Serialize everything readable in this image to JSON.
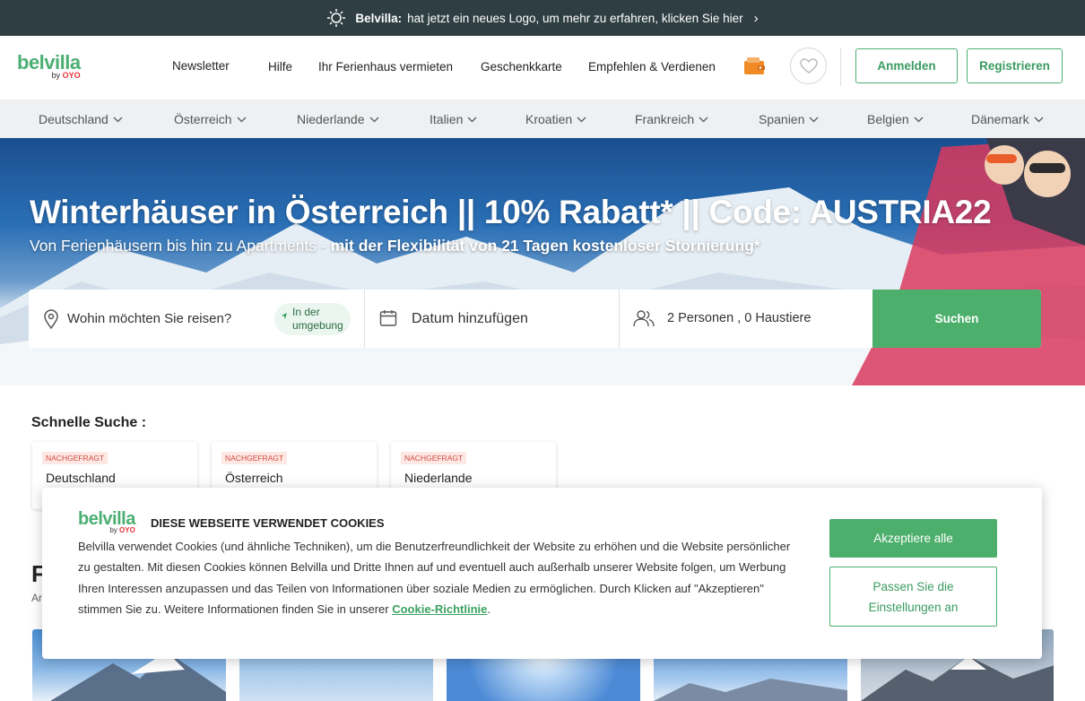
{
  "announcement": {
    "brand": "Belvilla:",
    "text": "hat jetzt ein neues Logo, um mehr zu erfahren, klicken Sie hier"
  },
  "header": {
    "logo": {
      "word": "belvilla",
      "by": "by",
      "oyo": "OYO"
    },
    "nav": [
      "Newsletter",
      "Hilfe",
      "Ihr Ferienhaus vermieten",
      "Geschenkkarte",
      "Empfehlen & Verdienen"
    ],
    "login_label": "Anmelden",
    "register_label": "Registrieren"
  },
  "countries": [
    "Deutschland",
    "Österreich",
    "Niederlande",
    "Italien",
    "Kroatien",
    "Frankreich",
    "Spanien",
    "Belgien",
    "Dänemark"
  ],
  "hero": {
    "title": "Winterhäuser in Österreich || 10% Rabatt* || Code: AUSTRIA22",
    "subtitle_plain": "Von Ferienhäusern bis hin zu Apartments - ",
    "subtitle_bold": "mit der Flexibilität von 21 Tagen kostenloser Stornierung*"
  },
  "search": {
    "destination_placeholder": "Wohin möchten Sie reisen?",
    "nearby_line1": "In der",
    "nearby_line2": "umgebung",
    "date_placeholder": "Datum hinzufügen",
    "guests": "2 Personen , 0 Haustiere",
    "button": "Suchen"
  },
  "quick_search": {
    "title": "Schnelle Suche :",
    "cards": [
      {
        "tag": "NACHGEFRAGT",
        "name": "Deutschland"
      },
      {
        "tag": "NACHGEFRAGT",
        "name": "Österreich"
      },
      {
        "tag": "NACHGEFRAGT",
        "name": "Niederlande"
      }
    ]
  },
  "background_section": {
    "title": "F",
    "small": "Ar"
  },
  "cookie": {
    "logo": {
      "word": "belvilla",
      "by": "by",
      "oyo": "OYO"
    },
    "title": "DIESE WEBSEITE VERWENDET COOKIES",
    "text": "Belvilla verwendet Cookies (und ähnliche Techniken), um die Benutzerfreundlichkeit der Website zu erhöhen und die Website persönlicher zu gestalten. Mit diesen Cookies können Belvilla und Dritte Ihnen auf und eventuell auch außerhalb unserer Website folgen, um Werbung Ihren Interessen anzupassen und das Teilen von Informationen über soziale Medien zu ermöglichen. Durch Klicken auf \"Akzeptieren\" stimmen Sie zu. Weitere Informationen finden Sie in unserer ",
    "link": "Cookie-Richtlinie",
    "after_link": ".",
    "accept_label": "Akzeptiere alle",
    "customize_label": "Passen Sie die Einstellungen an"
  },
  "colors": {
    "brand_green": "#4caf6c",
    "announce_bg": "#2e3e43",
    "country_bar": "#eef0f2"
  }
}
